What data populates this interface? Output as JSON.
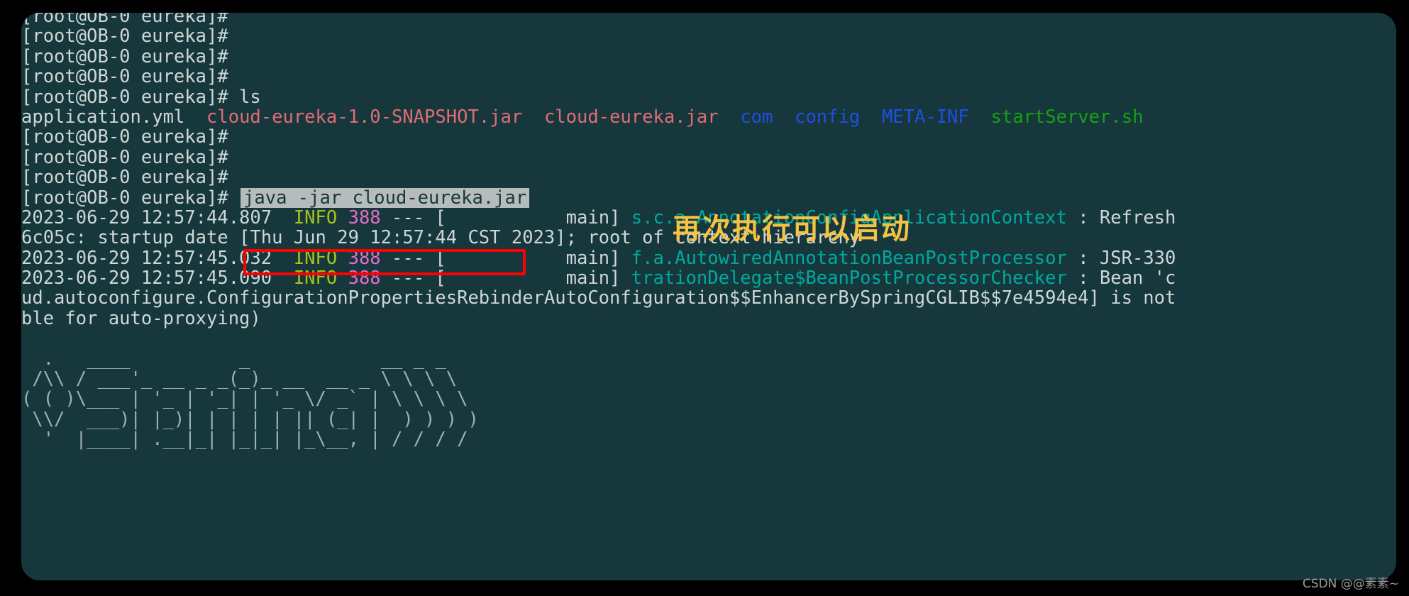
{
  "terminal": {
    "prompt": "[root@OB-0 eureka]#",
    "lines": [
      {
        "type": "prompt",
        "prompt": "[root@OB-0 eureka]#",
        "command": ""
      },
      {
        "type": "prompt",
        "prompt": "[root@OB-0 eureka]#",
        "command": ""
      },
      {
        "type": "prompt",
        "prompt": "[root@OB-0 eureka]#",
        "command": ""
      },
      {
        "type": "prompt",
        "prompt": "[root@OB-0 eureka]#",
        "command": ""
      },
      {
        "type": "prompt",
        "prompt": "[root@OB-0 eureka]#",
        "command": " ls"
      },
      {
        "type": "ls"
      },
      {
        "type": "prompt",
        "prompt": "[root@OB-0 eureka]#",
        "command": ""
      },
      {
        "type": "prompt",
        "prompt": "[root@OB-0 eureka]#",
        "command": ""
      },
      {
        "type": "prompt",
        "prompt": "[root@OB-0 eureka]#",
        "command": ""
      },
      {
        "type": "highlighted-command",
        "prompt": "[root@OB-0 eureka]#",
        "command": "java -jar cloud-eureka.jar"
      }
    ],
    "ls_output": [
      {
        "name": "application.yml",
        "kind": "file"
      },
      {
        "name": "cloud-eureka-1.0-SNAPSHOT.jar",
        "kind": "archive"
      },
      {
        "name": "cloud-eureka.jar",
        "kind": "archive"
      },
      {
        "name": "com",
        "kind": "dir"
      },
      {
        "name": "config",
        "kind": "dir"
      },
      {
        "name": "META-INF",
        "kind": "dir"
      },
      {
        "name": "startServer.sh",
        "kind": "exec"
      }
    ],
    "highlighted_command": "java -jar cloud-eureka.jar",
    "log_lines": [
      {
        "timestamp": "2023-06-29 12:57:44.807",
        "level": "INFO",
        "pid": "388",
        "separator": "---",
        "thread": "[           main]",
        "logger": "s.c.a.AnnotationConfigApplicationContext",
        "message": ": Refresh"
      },
      {
        "wrap": "6c05c: startup date [Thu Jun 29 12:57:44 CST 2023]; root of context hierarchy"
      },
      {
        "timestamp": "2023-06-29 12:57:45.032",
        "level": "INFO",
        "pid": "388",
        "separator": "---",
        "thread": "[           main]",
        "logger": "f.a.AutowiredAnnotationBeanPostProcessor",
        "message": ": JSR-330"
      },
      {
        "timestamp": "2023-06-29 12:57:45.090",
        "level": "INFO",
        "pid": "388",
        "separator": "---",
        "thread": "[           main]",
        "logger": "trationDelegate$BeanPostProcessorChecker",
        "message": ": Bean 'c"
      },
      {
        "wrap": "ud.autoconfigure.ConfigurationPropertiesRebinderAutoConfiguration$$EnhancerBySpringCGLIB$$7e4594e4] is not"
      },
      {
        "wrap": "ble for auto-proxying)"
      }
    ],
    "banner": [
      "  .   ____          _            __ _ _",
      " /\\\\ / ___'_ __ _ _(_)_ __  __ _ \\ \\ \\ \\",
      "( ( )\\___ | '_ | '_| | '_ \\/ _` | \\ \\ \\ \\",
      " \\\\/  ___)| |_)| | | | | || (_| |  ) ) ) )",
      "  '  |____| .__|_| |_|_| |_\\__, | / / / /"
    ]
  },
  "annotation": {
    "text": "再次执行可以启动",
    "color": "#f5c343"
  },
  "watermark": {
    "text": "CSDN @@素素~"
  },
  "colors": {
    "terminal_background": "#16383c",
    "page_background": "#000000",
    "default_text": "#cfd6d6",
    "directory": "#1f4fe0",
    "archive": "#e06c75",
    "executable": "#16a016",
    "log_level": "#a6c21a",
    "pid": "#e46ccb",
    "logger": "#00a99d",
    "highlight_background": "#b6bbbb",
    "annotation_box_border": "#ff0000"
  }
}
